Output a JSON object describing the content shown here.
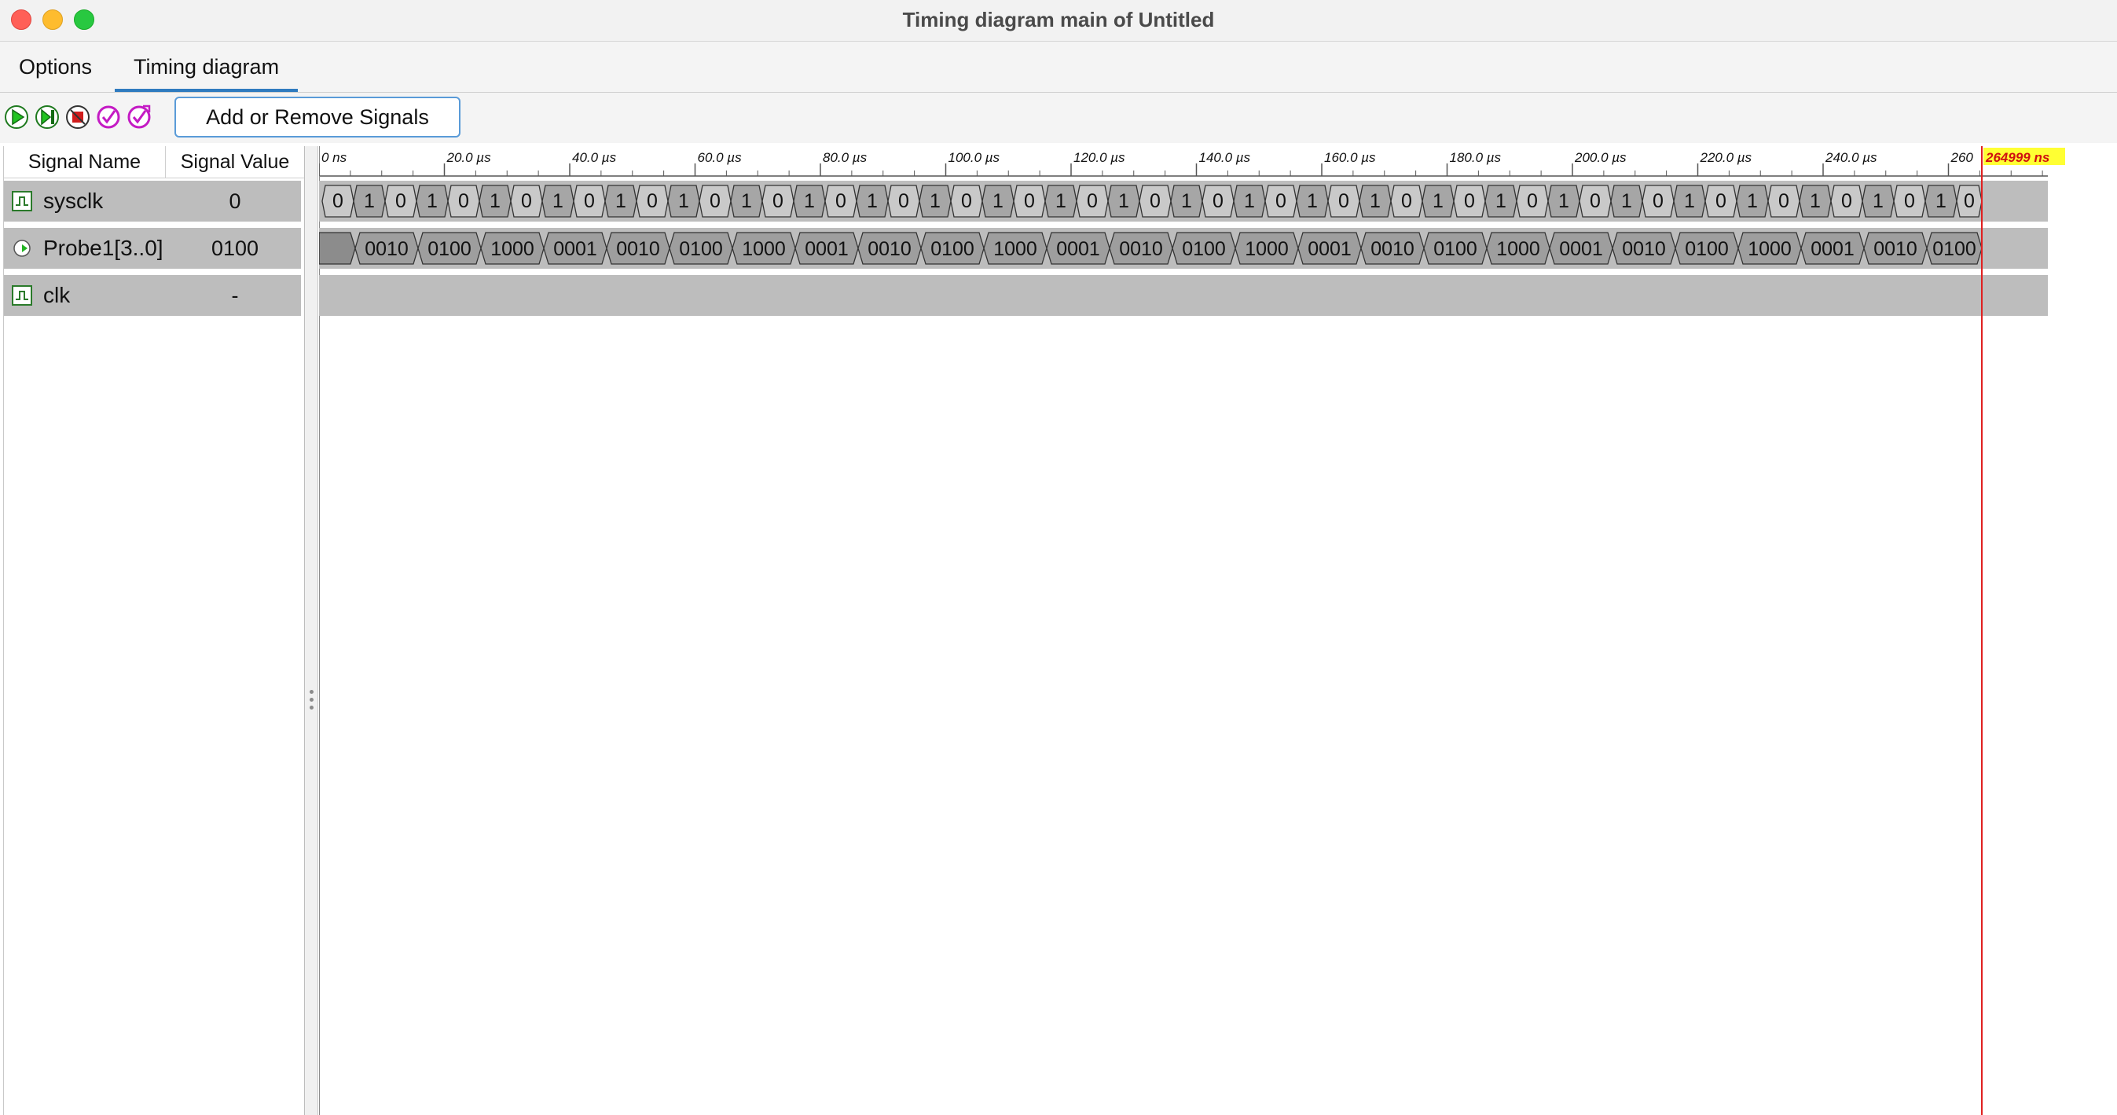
{
  "window": {
    "title": "Timing diagram main of Untitled"
  },
  "tabs": [
    {
      "label": "Options",
      "active": false
    },
    {
      "label": "Timing diagram",
      "active": true
    }
  ],
  "toolbar": {
    "icons": [
      "run-icon",
      "step-icon",
      "stop-icon",
      "trigger-icon",
      "trigger-reset-icon"
    ],
    "add_remove_label": "Add or Remove Signals"
  },
  "signal_panel": {
    "col_name": "Signal Name",
    "col_value": "Signal Value",
    "signals": [
      {
        "name": "sysclk",
        "value": "0",
        "icon": "waveform-icon"
      },
      {
        "name": "Probe1[3..0]",
        "value": "0100",
        "icon": "probe-icon"
      },
      {
        "name": "clk",
        "value": "-",
        "icon": "waveform-icon"
      }
    ]
  },
  "timeline": {
    "tick_labels": [
      "0 ns",
      "20.0 µs",
      "40.0 µs",
      "60.0 µs",
      "80.0 µs",
      "100.0 µs",
      "120.0 µs",
      "140.0 µs",
      "160.0 µs",
      "180.0 µs",
      "200.0 µs",
      "220.0 µs",
      "240.0 µs",
      "260"
    ],
    "cursor_label": "264999 ns",
    "cursor_color": "#e02020",
    "cursor_label_bg": "#ffff33"
  },
  "waveforms": {
    "sysclk_values": [
      "0",
      "1",
      "0",
      "1",
      "0",
      "1",
      "0",
      "1",
      "0",
      "1",
      "0",
      "1",
      "0",
      "1",
      "0",
      "1",
      "0",
      "1",
      "0",
      "1",
      "0",
      "1",
      "0",
      "1",
      "0",
      "1",
      "0",
      "1",
      "0",
      "1",
      "0",
      "1",
      "0",
      "1",
      "0",
      "1",
      "0",
      "1",
      "0",
      "1",
      "0",
      "1",
      "0",
      "1",
      "0",
      "1",
      "0",
      "1",
      "0",
      "1",
      "0",
      "1",
      "0"
    ],
    "probe_values": [
      "0010",
      "0100",
      "1000",
      "0001",
      "0010",
      "0100",
      "1000",
      "0001",
      "0010",
      "0100",
      "1000",
      "0001",
      "0010",
      "0100",
      "1000",
      "0001",
      "0010",
      "0100",
      "1000",
      "0001",
      "0010",
      "0100",
      "1000",
      "0001",
      "0010",
      "0100"
    ]
  },
  "colors": {
    "wave_fill": "#c9c9c9",
    "wave_high": "#a6a6a6",
    "probe_fill": "#9e9e9e",
    "row_bg": "#bdbdbd",
    "accent": "#2f7bbf"
  }
}
